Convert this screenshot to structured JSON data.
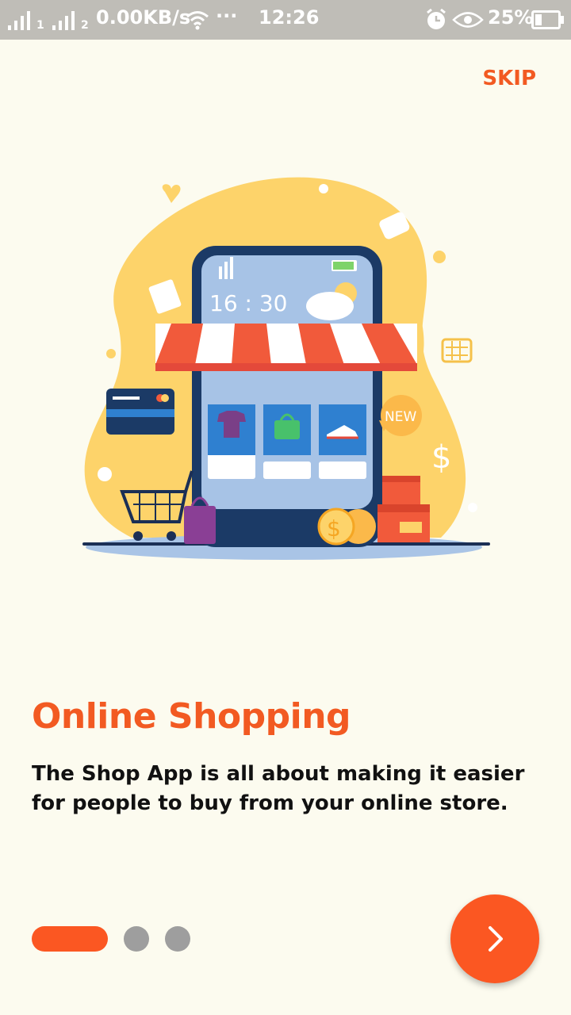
{
  "status_bar": {
    "sim1_label": "1",
    "sim2_label": "2",
    "network_speed": "0.00KB/s",
    "more": "···",
    "time": "12:26",
    "battery": "25%",
    "icons": [
      "signal-icon",
      "wifi-icon",
      "alarm-icon",
      "eye-icon",
      "battery-icon"
    ]
  },
  "skip_label": "SKIP",
  "illustration": {
    "phone_time": "16 : 30",
    "badge": "NEW",
    "currency_symbol": "$"
  },
  "title": "Online Shopping",
  "description": "The Shop App is all about making it easier for people to buy from your online store.",
  "pager": {
    "current": 1,
    "total": 3
  },
  "next_icon": "chevron-right-icon",
  "colors": {
    "accent": "#fb5722",
    "title": "#f25a22",
    "background": "#fcfbef",
    "status_bar": "#bfbdb7",
    "dot_inactive": "#9e9e9e"
  }
}
